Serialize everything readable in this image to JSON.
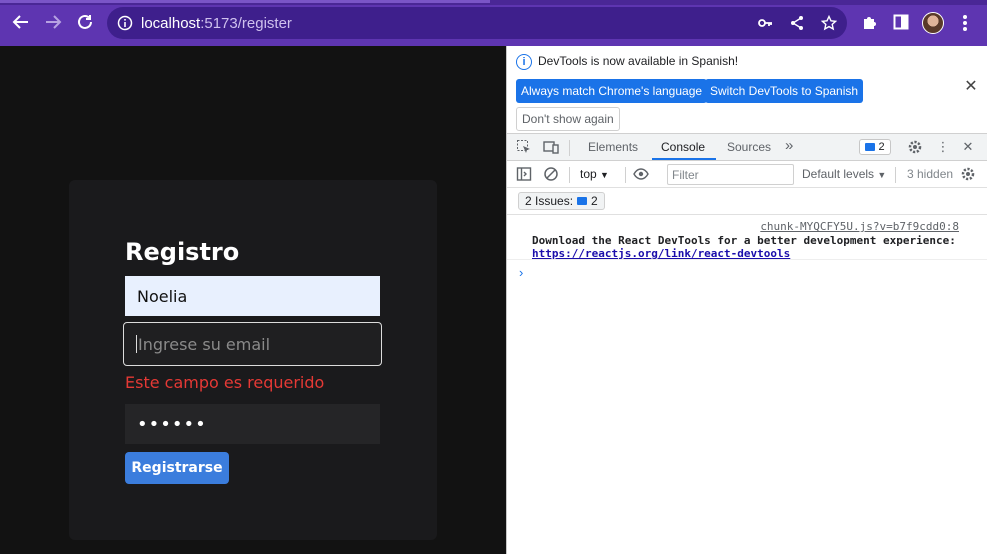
{
  "browser": {
    "url_host": "localhost",
    "url_path": ":5173/register"
  },
  "form": {
    "title": "Registro",
    "name_value": "Noelia",
    "email_placeholder": "Ingrese su email",
    "email_error": "Este campo es requerido",
    "password_masked": "••••••",
    "submit_label": "Registrarse"
  },
  "devtools": {
    "infobar": {
      "message": "DevTools is now available in Spanish!",
      "btn_match": "Always match Chrome's language",
      "btn_switch": "Switch DevTools to Spanish",
      "btn_dismiss": "Don't show again"
    },
    "tabs": {
      "elements": "Elements",
      "console": "Console",
      "sources": "Sources",
      "more": "»",
      "issues_count": "2"
    },
    "console_bar": {
      "context": "top",
      "filter_placeholder": "Filter",
      "levels": "Default levels",
      "hidden": "3 hidden"
    },
    "issues": {
      "label": "2 Issues:",
      "count": "2"
    },
    "log": {
      "source": "chunk-MYQCFY5U.js?v=b7f9cdd0:8",
      "message": "Download the React DevTools for a better development experience:",
      "link": "https://reactjs.org/link/react-devtools"
    },
    "prompt": "›"
  },
  "colors": {
    "chrome_toolbar": "#5e35b1",
    "accent_blue": "#1a73e8",
    "error_red": "#e53935",
    "submit_button": "#3b7ddd"
  }
}
